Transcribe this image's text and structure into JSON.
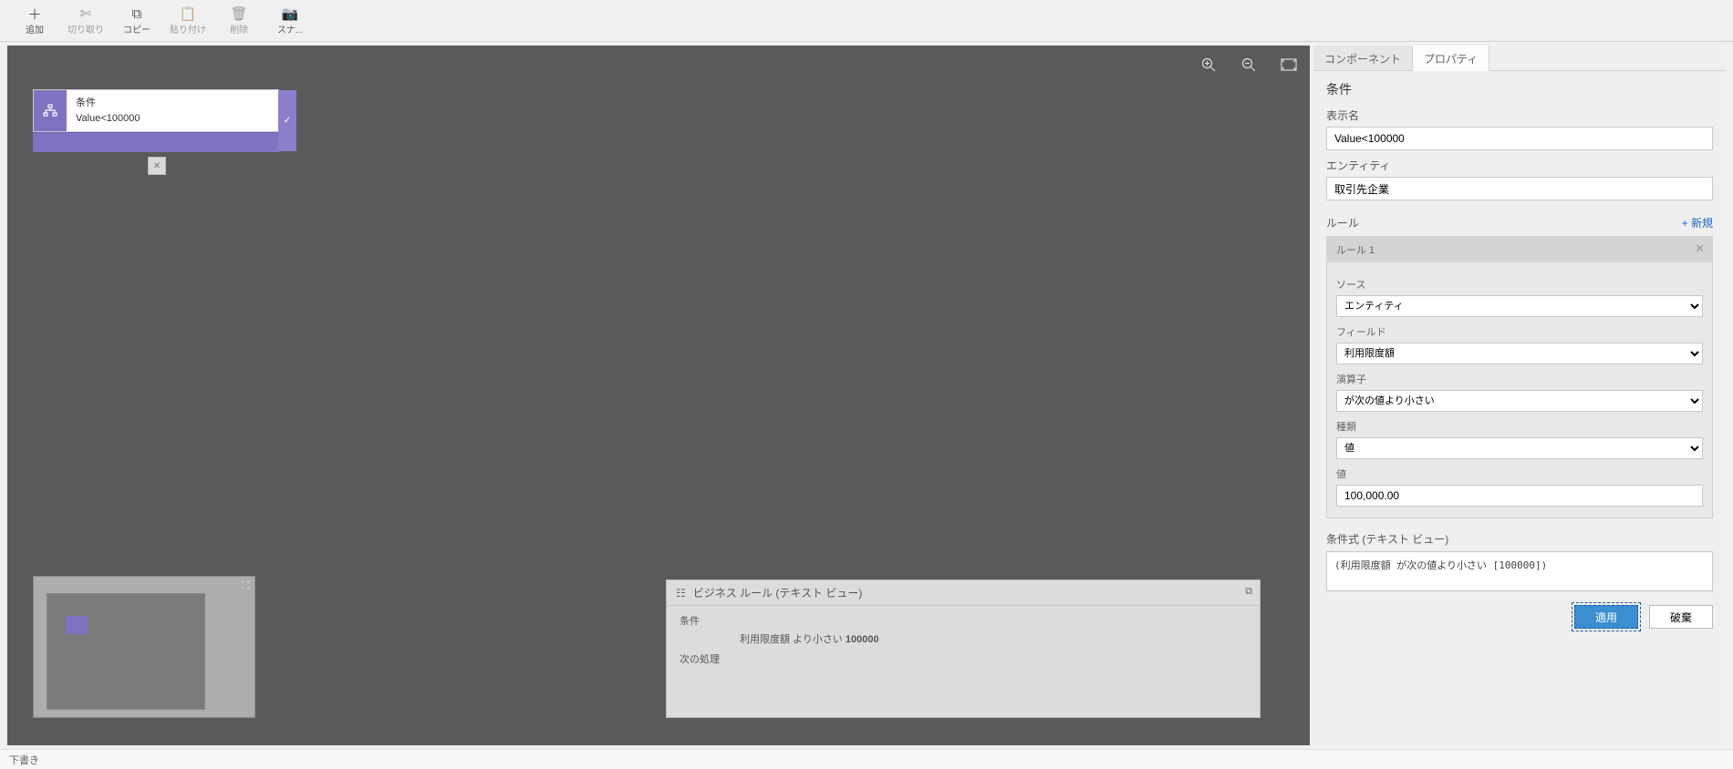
{
  "toolbar": {
    "add": "追加",
    "cut": "切り取り",
    "copy": "コピー",
    "paste": "貼り付け",
    "delete": "削除",
    "snapshot": "スナ..."
  },
  "canvas": {
    "node": {
      "title": "条件",
      "subtitle": "Value<100000"
    },
    "textview": {
      "header": "ビジネス ルール (テキスト ビュー)",
      "cond_label": "条件",
      "cond_text_prefix": "利用限度額 より小さい ",
      "cond_text_value": "100000",
      "next_label": "次の処理"
    }
  },
  "panel": {
    "tabs": {
      "components": "コンポーネント",
      "properties": "プロパティ"
    },
    "title": "条件",
    "display_name_label": "表示名",
    "display_name_value": "Value<100000",
    "entity_label": "エンティティ",
    "entity_value": "取引先企業",
    "rules_label": "ルール",
    "add_new": "+ 新規",
    "rule1": {
      "header": "ルール 1",
      "source_label": "ソース",
      "source_value": "エンティティ",
      "field_label": "フィールド",
      "field_value": "利用限度額",
      "operator_label": "演算子",
      "operator_value": "が次の値より小さい",
      "type_label": "種類",
      "type_value": "値",
      "value_label": "値",
      "value_value": "100,000.00"
    },
    "expr_label": "条件式 (テキスト ビュー)",
    "expr_value": "(利用限度額 が次の値より小さい [100000])",
    "apply": "適用",
    "discard": "破棄"
  },
  "footer": {
    "status": "下書き"
  }
}
